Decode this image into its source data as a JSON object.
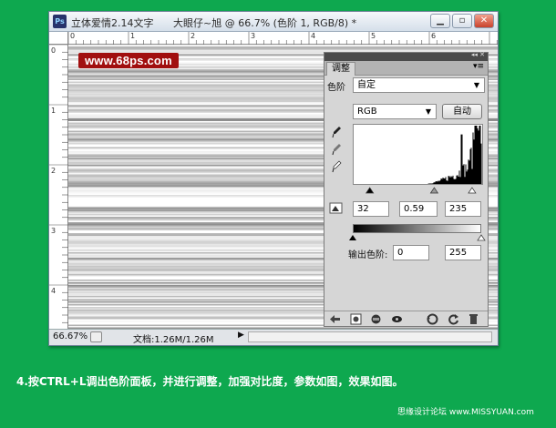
{
  "window": {
    "app_icon": "Ps",
    "doc_title": "立体爱情2.14文字",
    "doc_subtitle": "大眼仔~旭 @ 66.7% (色阶 1, RGB/8) *",
    "minimize_glyph": "▁",
    "restore_glyph": "▫",
    "close_glyph": "✕"
  },
  "rulers": {
    "top": [
      "0",
      "1",
      "2",
      "3",
      "4",
      "5",
      "6"
    ],
    "left": [
      "0",
      "1",
      "2",
      "3",
      "4"
    ]
  },
  "canvas": {
    "watermark": "www.68ps.com"
  },
  "status_bar": {
    "zoom": "66.67%",
    "doc_info": "文档:1.26M/1.26M",
    "arrow": "▶"
  },
  "adjust_panel": {
    "collapse_glyph": "◂◂ ✕",
    "tab_label": "调整",
    "menu_glyph": "▾≡",
    "preset_label": "色阶",
    "preset_value": "自定",
    "channel_value": "RGB",
    "auto_button": "自动",
    "input_black": "32",
    "input_gamma": "0.59",
    "input_white": "235",
    "output_label": "输出色阶:",
    "output_black": "0",
    "output_white": "255",
    "footer_icons": [
      "back-arrow-icon",
      "layer-mask-icon",
      "clip-layer-icon",
      "visibility-eye-icon",
      "view-previous-icon",
      "reset-icon",
      "delete-icon"
    ],
    "histogram": {
      "channel": "RGB",
      "black_point": 32,
      "gamma": 0.59,
      "white_point": 235
    }
  },
  "caption": "4.按CTRL+L调出色阶面板，并进行调整，加强对比度，参数如图，效果如图。",
  "credit": "思缘设计论坛 www.MISSYUAN.com",
  "colors": {
    "background": "#0ea84f",
    "watermark_bg": "#a10f0f",
    "panel_header": "#4a4a4a"
  }
}
